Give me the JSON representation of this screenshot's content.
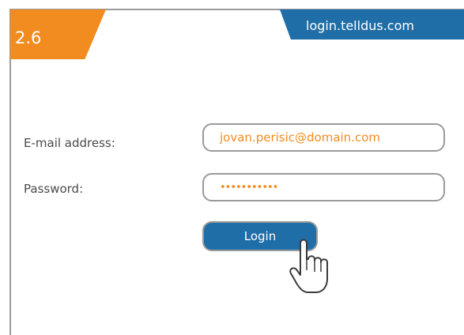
{
  "step": {
    "number": "2.6"
  },
  "url_tab": {
    "text": "login.telldus.com"
  },
  "form": {
    "email": {
      "label": "E-mail address:",
      "value": "jovan.perisic@domain.com"
    },
    "password": {
      "label": "Password:",
      "value": "•••••••••••"
    },
    "login_button": {
      "label": "Login"
    }
  },
  "colors": {
    "accent_orange": "#f28c20",
    "brand_blue": "#1f6ea8",
    "border_gray": "#9a9a9a"
  },
  "icons": {
    "cursor": "hand-pointer-icon"
  }
}
